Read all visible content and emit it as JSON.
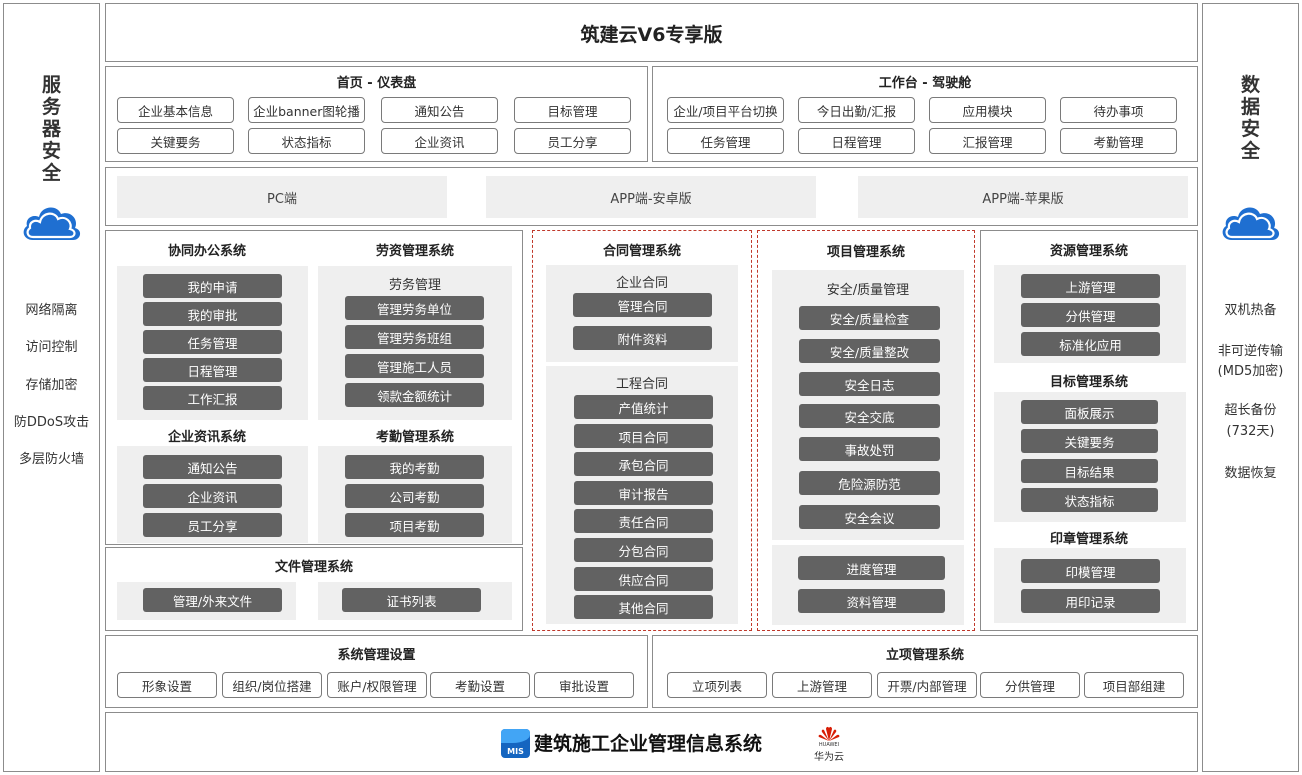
{
  "left": {
    "title_chars": [
      "服",
      "务",
      "器",
      "安",
      "全"
    ],
    "items": [
      "网络隔离",
      "访问控制",
      "存储加密",
      "防DDoS攻击",
      "多层防火墙"
    ]
  },
  "right": {
    "title_chars": [
      "数",
      "据",
      "安",
      "全"
    ],
    "items": [
      "双机热备",
      "非可逆传输",
      "(MD5加密)",
      "超长备份",
      "(732天)",
      "数据恢复"
    ]
  },
  "header": {
    "title": "筑建云V6专享版"
  },
  "dashboard": {
    "title": "首页 - 仪表盘",
    "buttons": [
      "企业基本信息",
      "企业banner图轮播",
      "通知公告",
      "目标管理",
      "关键要务",
      "状态指标",
      "企业资讯",
      "员工分享"
    ]
  },
  "workbench": {
    "title": "工作台 - 驾驶舱",
    "buttons": [
      "企业/项目平台切换",
      "今日出勤/汇报",
      "应用模块",
      "待办事项",
      "任务管理",
      "日程管理",
      "汇报管理",
      "考勤管理"
    ]
  },
  "platforms": [
    "PC端",
    "APP端-安卓版",
    "APP端-苹果版"
  ],
  "collab": {
    "title": "协同办公系统",
    "items": [
      "我的申请",
      "我的审批",
      "任务管理",
      "日程管理",
      "工作汇报"
    ]
  },
  "labor": {
    "title": "劳资管理系统",
    "sub": "劳务管理",
    "items": [
      "管理劳务单位",
      "管理劳务班组",
      "管理施工人员",
      "领款金额统计"
    ]
  },
  "news": {
    "title": "企业资讯系统",
    "items": [
      "通知公告",
      "企业资讯",
      "员工分享"
    ]
  },
  "attendance": {
    "title": "考勤管理系统",
    "items": [
      "我的考勤",
      "公司考勤",
      "项目考勤"
    ]
  },
  "files": {
    "title": "文件管理系统",
    "items": [
      "管理/外来文件",
      "证书列表"
    ]
  },
  "contract": {
    "title": "合同管理系统",
    "group1": {
      "sub": "企业合同",
      "items": [
        "管理合同",
        "附件资料"
      ]
    },
    "group2": {
      "sub": "工程合同",
      "items": [
        "产值统计",
        "项目合同",
        "承包合同",
        "审计报告",
        "责任合同",
        "分包合同",
        "供应合同",
        "其他合同"
      ]
    }
  },
  "project": {
    "title": "项目管理系统",
    "group1": {
      "sub": "安全/质量管理",
      "items": [
        "安全/质量检查",
        "安全/质量整改",
        "安全日志",
        "安全交底",
        "事故处罚",
        "危险源防范",
        "安全会议"
      ]
    },
    "group2": {
      "items": [
        "进度管理",
        "资料管理"
      ]
    }
  },
  "resource": {
    "title": "资源管理系统",
    "items": [
      "上游管理",
      "分供管理",
      "标准化应用"
    ]
  },
  "target": {
    "title": "目标管理系统",
    "items": [
      "面板展示",
      "关键要务",
      "目标结果",
      "状态指标"
    ]
  },
  "seal": {
    "title": "印章管理系统",
    "items": [
      "印模管理",
      "用印记录"
    ]
  },
  "settings": {
    "title": "系统管理设置",
    "items": [
      "形象设置",
      "组织/岗位搭建",
      "账户/权限管理",
      "考勤设置",
      "审批设置"
    ]
  },
  "approval": {
    "title": "立项管理系统",
    "items": [
      "立项列表",
      "上游管理",
      "开票/内部管理",
      "分供管理",
      "项目部组建"
    ]
  },
  "footer": {
    "logo_text": "MIS",
    "title": "建筑施工企业管理信息系统",
    "brand_en": "HUAWEI",
    "brand_cn": "华为云"
  },
  "colors": {
    "dark_button": "#626262",
    "panel_gray": "#efefef",
    "border": "#8c8c8c",
    "dashed": "#c0392b",
    "cloud": "#1f6fd1"
  }
}
